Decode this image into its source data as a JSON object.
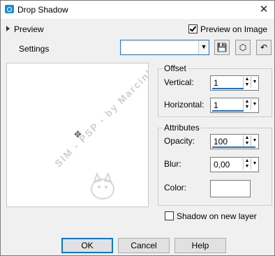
{
  "window": {
    "title": "Drop Shadow",
    "close": "✕"
  },
  "preview": {
    "label": "Preview",
    "on_image_label": "Preview on Image",
    "on_image_checked": true
  },
  "settings": {
    "label": "Settings",
    "value": ""
  },
  "toolbar": {
    "save_icon": "💾",
    "reset_icon": "⬡",
    "restore_icon": "↶"
  },
  "offset": {
    "title": "Offset",
    "vertical_label": "Vertical:",
    "vertical_value": "1",
    "horizontal_label": "Horizontal:",
    "horizontal_value": "1"
  },
  "attributes": {
    "title": "Attributes",
    "opacity_label": "Opacity:",
    "opacity_value": "100",
    "blur_label": "Blur:",
    "blur_value": "0,00",
    "color_label": "Color:",
    "color_value": "#ffffff"
  },
  "shadow_on_new_layer": {
    "label": "Shadow on new layer",
    "checked": false
  },
  "buttons": {
    "ok": "OK",
    "cancel": "Cancel",
    "help": "Help"
  },
  "watermark": {
    "text": "SIM - PSP - by Marcinha"
  }
}
